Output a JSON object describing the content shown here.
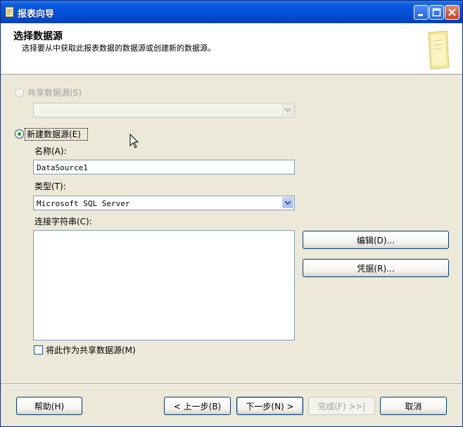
{
  "window": {
    "title": "报表向导"
  },
  "header": {
    "title": "选择数据源",
    "subtitle": "选择要从中获取此报表数据的数据源或创建新的数据源。"
  },
  "shared_source": {
    "label": "共享数据源(S)",
    "selected_value": ""
  },
  "new_source": {
    "label": "新建数据源(E)",
    "name_label": "名称(A):",
    "name_value": "DataSource1",
    "type_label": "类型(T):",
    "type_value": "Microsoft SQL Server",
    "conn_label": "连接字符串(C):",
    "conn_value": ""
  },
  "side_buttons": {
    "edit": "编辑(D)...",
    "credentials": "凭据(R)..."
  },
  "make_shared": {
    "label": "将此作为共享数据源(M)",
    "checked": false
  },
  "footer": {
    "help": "帮助(H)",
    "back": "< 上一步(B)",
    "next": "下一步(N) >",
    "finish": "完成(F) >>|",
    "cancel": "取消"
  },
  "colors": {
    "titlebar": "#0350d8",
    "dialog_bg": "#ece9d8",
    "radio_dot": "#21a121"
  },
  "icons": [
    "report-wizard-icon",
    "minimize-icon",
    "maximize-icon",
    "close-icon",
    "wizard-page-icon",
    "dropdown-arrow-icon",
    "mouse-cursor-icon"
  ]
}
